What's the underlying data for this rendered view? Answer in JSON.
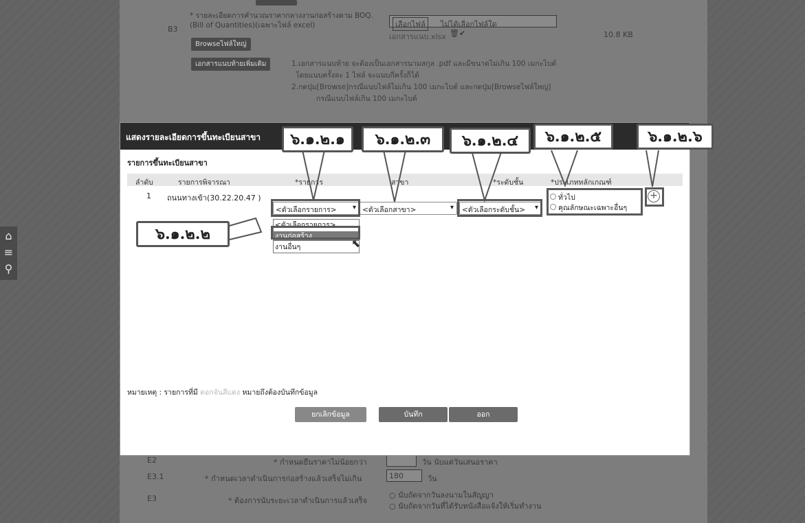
{
  "background_form": {
    "b3_code": "B3",
    "b3_label": "* รายละเอียดการคำนวณราคากลางงานก่อสร้างตาม BOQ. (Bill of Quantities)(เฉพาะไฟล์ excel)",
    "browse_large_label": "Browseไฟล์ใหญ่",
    "choose_file_label": "เลือกไฟล์",
    "no_file_label": "ไม่ได้เลือกไฟล์ใด",
    "attached_file": "เอกสารแนบ.xlsx",
    "file_size": "10.8 KB",
    "extra_docs_button": "เอกสารแนบท้ายเพิ่มเติม",
    "doc_note_1": "1.เอกสารแนบท้าย จะต้องเป็นเอกสารนามสกุล .pdf และมีขนาดไม่เกิน 100 เมกะไบต์",
    "doc_note_1b": "โดยแนบครั้งละ 1 ไฟล์ จะแนบกี่ครั้งก็ได้",
    "doc_note_2": "2.กดปุ่ม[Browse]กรณีแนบไฟล์ไม่เกิน 100 เมกะไบต์ และกดปุ่ม[Browseไฟล์ใหญ่]",
    "doc_note_2b": "กรณีแนบไฟล์เกิน 100 เมกะไบต์",
    "e2_code": "E2",
    "e2_label": "* กำหนดยืนราคาไม่น้อยกว่า",
    "e2_suffix": "วัน นับแต่วันเสนอราคา",
    "e31_code": "E3.1",
    "e31_label": "* กำหนดเวลาดำเนินการก่อสร้างแล้วเสร็จไม่เกิน",
    "e31_value": "180",
    "e31_unit": "วัน",
    "e3_code": "E3",
    "e3_label": "* ต้องการนับระยะเวลาดำเนินการแล้วเสร็จ",
    "e3_opt1": "นับถัดจากวันลงนามในสัญญา",
    "e3_opt2": "นับถัดจากวันที่ได้รับหนังสือแจ้งให้เริ่มทำงาน"
  },
  "modal": {
    "title": "แสดงรายละเอียดการขึ้นทะเบียนสาขา",
    "section_title": "รายการขึ้นทะเบียนสาขา",
    "columns": [
      "ลำดับ",
      "รายการพิจารณา",
      "*รายการ",
      "สาขา",
      "*ระดับชั้น",
      "*ประเภทหลักเกณฑ์"
    ],
    "row": {
      "index": "1",
      "item": "ถนนทางเข้า(30.22.20.47 )",
      "select_item": "<ตัวเลือกรายการ>",
      "select_branch": "<ตัวเลือกสาขา>",
      "select_level": "<ตัวเลือกระดับชั้น>",
      "radio_general": "ทั่วไป",
      "radio_special": "คุณลักษณะเฉพาะอื่นๆ"
    },
    "dropdown_options": [
      "<ตัวเลือกรายการ>",
      "งานก่อสร้าง",
      "งานอื่นๆ"
    ],
    "note_prefix": "หมายเหตุ : รายการที่มี",
    "note_red": "ดอกจันสีแดง",
    "note_suffix": "หมายถึงต้องบันทึกข้อมูล",
    "btn_cancel": "ยกเลิกข้อมูล",
    "btn_save": "บันทึก",
    "btn_exit": "ออก"
  },
  "callouts": {
    "c1": "๖.๑.๒.๑",
    "c2": "๖.๑.๒.๒",
    "c3": "๖.๑.๒.๓",
    "c4": "๖.๑.๒.๔",
    "c5": "๖.๑.๒.๕",
    "c6": "๖.๑.๒.๖"
  }
}
